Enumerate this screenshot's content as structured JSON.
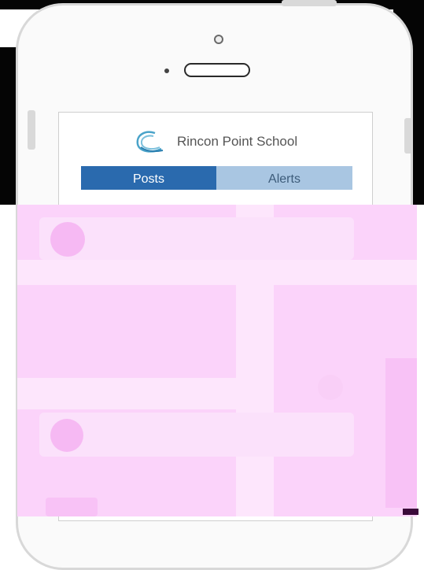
{
  "app": {
    "school_name": "Rincon Point School"
  },
  "tabs": [
    {
      "label": "Posts",
      "selected": true
    },
    {
      "label": "Alerts",
      "selected": false
    }
  ],
  "posts": [
    {
      "avatar_initials": ""
    },
    {
      "avatar_initials": "",
      "author_line": "",
      "subline": ""
    }
  ],
  "colors": {
    "tab_selected_bg": "#2a6aae",
    "tab_unselected_bg": "#a9c6e2",
    "overlay_pink": "#fbd3fa"
  },
  "icons": {
    "school_logo": "wave-logo-icon",
    "camera": "front-camera-icon",
    "speaker": "earpiece-speaker-icon"
  }
}
